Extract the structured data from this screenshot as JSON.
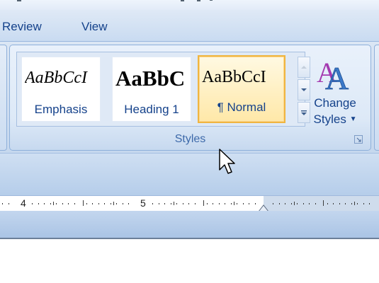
{
  "ribbon": {
    "tabs": [
      {
        "label": "Review"
      },
      {
        "label": "View"
      }
    ],
    "styles_group": {
      "label": "Styles",
      "gallery": [
        {
          "sample": "AaBbCcI",
          "name": "Emphasis"
        },
        {
          "sample": "AaBbC",
          "name": "Heading 1"
        },
        {
          "sample": "AaBbCcI",
          "name": "¶ Normal",
          "selected": true
        }
      ],
      "change_styles": {
        "line1": "Change",
        "line2": "Styles"
      }
    }
  },
  "ruler": {
    "numbers": [
      "4",
      "5"
    ]
  },
  "colors": {
    "ribbon_text": "#15428b",
    "selected_border": "#f0b540",
    "ribbon_bg": "#dbe6f4"
  }
}
